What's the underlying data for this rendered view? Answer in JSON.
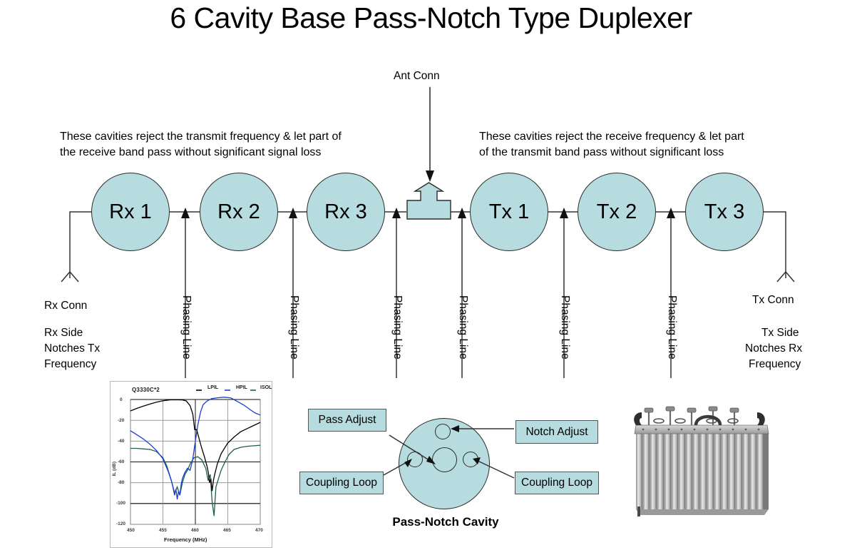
{
  "page": {
    "title": "6 Cavity Base Pass-Notch Type Duplexer",
    "background": "#ffffff",
    "cavity_fill": "#b6dce0",
    "line_color": "#333333"
  },
  "annotations": {
    "ant_conn": "Ant Conn",
    "left_note_line1": "These cavities reject the transmit frequency & let part of",
    "left_note_line2": "the receive band pass without significant signal loss",
    "right_note_line1": "These cavities reject the receive frequency & let part",
    "right_note_line2": "of the transmit band pass without significant loss",
    "rx_conn": "Rx Conn",
    "rx_side_line1": "Rx Side",
    "rx_side_line2": "Notches Tx",
    "rx_side_line3": "Frequency",
    "tx_conn": "Tx Conn",
    "tx_side_line1": "Tx Side",
    "tx_side_line2": "Notches Rx",
    "tx_side_line3": "Frequency",
    "phasing_line": "Phasing Line"
  },
  "cavities": [
    {
      "label": "Rx 1"
    },
    {
      "label": "Rx 2"
    },
    {
      "label": "Rx 3"
    },
    {
      "label": "Tx 1"
    },
    {
      "label": "Tx 2"
    },
    {
      "label": "Tx 3"
    }
  ],
  "phasing_lines": [
    {
      "label": "Phasing Line"
    },
    {
      "label": "Phasing Line"
    },
    {
      "label": "Phasing Line"
    },
    {
      "label": "Phasing Line"
    },
    {
      "label": "Phasing Line"
    },
    {
      "label": "Phasing Line"
    }
  ],
  "cavity_detail": {
    "caption": "Pass-Notch Cavity",
    "pass_adjust": "Pass Adjust",
    "notch_adjust": "Notch Adjust",
    "coupling_loop_left": "Coupling Loop",
    "coupling_loop_right": "Coupling Loop"
  },
  "chart_data": {
    "type": "line",
    "title": "Q3330C*2",
    "xlabel": "Frequency (MHz)",
    "ylabel": "IL (dB)",
    "xlim": [
      450,
      470
    ],
    "ylim": [
      -120,
      0
    ],
    "xticks": [
      450,
      455,
      460,
      465,
      470
    ],
    "yticks": [
      0,
      -20,
      -40,
      -60,
      -80,
      -100,
      -120
    ],
    "grid": true,
    "legend_position": "top-right",
    "series": [
      {
        "name": "LPIL",
        "color": "#000000",
        "x": [
          450,
          451,
          452,
          453,
          454,
          455,
          456,
          457,
          458,
          458.6,
          459.2,
          459.6,
          459.9,
          460.2,
          460.6,
          461,
          461.4,
          461.8,
          462,
          462.2,
          462.4,
          462.6,
          462.8,
          463,
          463.4,
          464,
          465,
          466,
          467,
          468,
          469,
          470
        ],
        "y": [
          -11,
          -8.5,
          -6.4,
          -4.4,
          -2.6,
          -1.2,
          -0.4,
          -0.2,
          -0.4,
          -1.4,
          -6,
          -14,
          -21,
          -29,
          -38,
          -47,
          -55,
          -64,
          -70,
          -80,
          -76,
          -88,
          -78,
          -72,
          -62,
          -52,
          -42,
          -36,
          -31,
          -28,
          -25,
          -22
        ]
      },
      {
        "name": "HPIL",
        "color": "#1a3fd4",
        "x": [
          450,
          451,
          452,
          453,
          454,
          455,
          455.8,
          456.4,
          456.8,
          457,
          457.2,
          457.4,
          457.6,
          457.8,
          458,
          458.4,
          458.8,
          459.2,
          459.6,
          460,
          460.4,
          460.8,
          461.2,
          461.8,
          462.5,
          463.5,
          464.5,
          465.5,
          466.5,
          467.5,
          468.5,
          469.2,
          470
        ],
        "y": [
          -30,
          -34,
          -38,
          -43,
          -49,
          -57,
          -68,
          -80,
          -92,
          -86,
          -96,
          -88,
          -92,
          -82,
          -76,
          -70,
          -66,
          -68,
          -58,
          -40,
          -24,
          -12,
          -5,
          -1.5,
          -0.6,
          -0.3,
          -0.2,
          -0.4,
          -2,
          -5.5,
          -10,
          -13,
          -15
        ]
      },
      {
        "name": "ISOL",
        "color": "#1f5f46",
        "x": [
          450,
          451,
          452,
          453,
          454,
          455,
          455.6,
          456.2,
          456.8,
          457.2,
          457.6,
          458,
          458.4,
          458.8,
          459.2,
          459.8,
          460.4,
          461,
          461.6,
          462,
          462.3,
          462.6,
          462.9,
          463.2,
          463.6,
          464,
          464.6,
          465.2,
          466,
          467,
          468,
          469,
          470
        ],
        "y": [
          -47,
          -47,
          -47.5,
          -48,
          -50,
          -56,
          -64,
          -76,
          -90,
          -84,
          -92,
          -80,
          -72,
          -68,
          -62,
          -56,
          -55,
          -58,
          -66,
          -78,
          -72,
          -98,
          -112,
          -84,
          -76,
          -68,
          -60,
          -53,
          -48,
          -46,
          -45,
          -44.5,
          -44
        ]
      }
    ]
  }
}
